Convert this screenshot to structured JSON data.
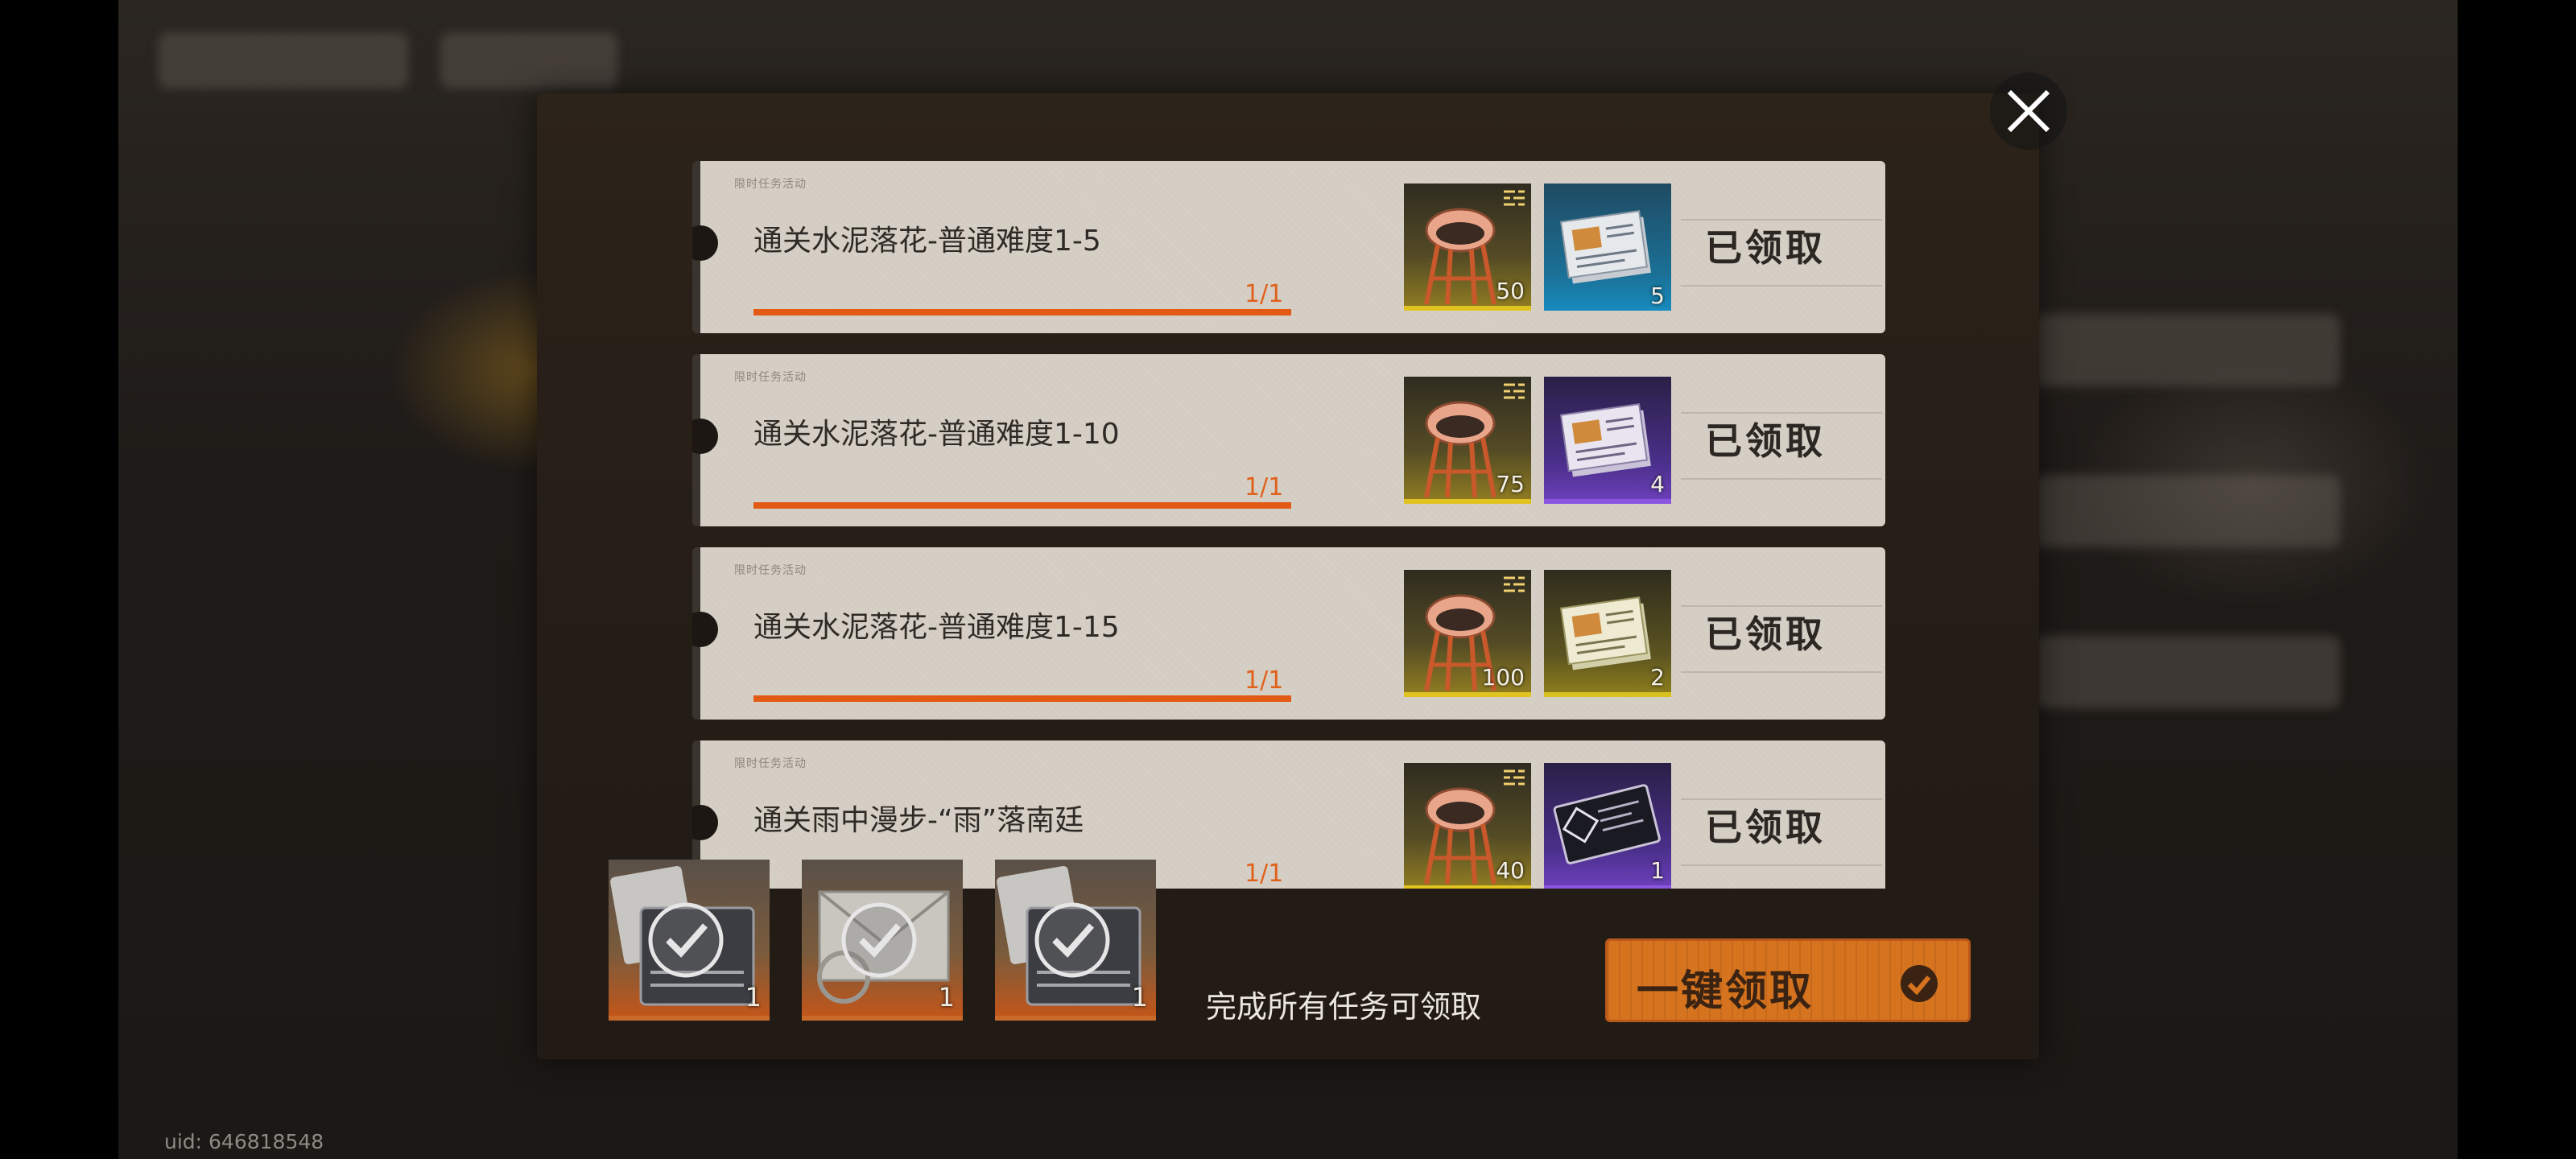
{
  "dialog": {
    "close_icon": "close-icon",
    "tasks": [
      {
        "tag": "限时任务活动",
        "title": "通关水泥落花-普通难度1-5",
        "progress": "1/1",
        "progress_fraction": 1.0,
        "rewards": [
          {
            "icon": "high-chair-icon",
            "rarity": "gold",
            "qty": "50"
          },
          {
            "icon": "document-stack-icon",
            "rarity": "blue",
            "qty": "5"
          }
        ],
        "status": "已领取"
      },
      {
        "tag": "限时任务活动",
        "title": "通关水泥落花-普通难度1-10",
        "progress": "1/1",
        "progress_fraction": 1.0,
        "rewards": [
          {
            "icon": "high-chair-icon",
            "rarity": "gold",
            "qty": "75"
          },
          {
            "icon": "document-stack-icon",
            "rarity": "purple",
            "qty": "4"
          }
        ],
        "status": "已领取"
      },
      {
        "tag": "限时任务活动",
        "title": "通关水泥落花-普通难度1-15",
        "progress": "1/1",
        "progress_fraction": 1.0,
        "rewards": [
          {
            "icon": "high-chair-icon",
            "rarity": "gold",
            "qty": "100"
          },
          {
            "icon": "document-stack-icon",
            "rarity": "yellow",
            "qty": "2"
          }
        ],
        "status": "已领取"
      },
      {
        "tag": "限时任务活动",
        "title": "通关雨中漫步-“雨”落南廷",
        "progress": "1/1",
        "progress_fraction": 1.0,
        "rewards": [
          {
            "icon": "high-chair-icon",
            "rarity": "gold",
            "qty": "40"
          },
          {
            "icon": "ticket-card-icon",
            "rarity": "purple",
            "qty": "1"
          }
        ],
        "status": "已领取"
      }
    ],
    "final_rewards": [
      {
        "icon": "console-device-icon",
        "qty": "1"
      },
      {
        "icon": "envelope-icon",
        "qty": "1"
      },
      {
        "icon": "console-device-icon",
        "qty": "1"
      }
    ],
    "hint": "完成所有任务可领取",
    "claim_all_label": "一键领取",
    "claim_all_icon": "check-circle-icon"
  },
  "footer": {
    "uid": "uid: 646818548"
  },
  "colors": {
    "accent_orange": "#e25a13",
    "button_orange": "#d6731e",
    "card_bg": "#d3cdc3"
  }
}
